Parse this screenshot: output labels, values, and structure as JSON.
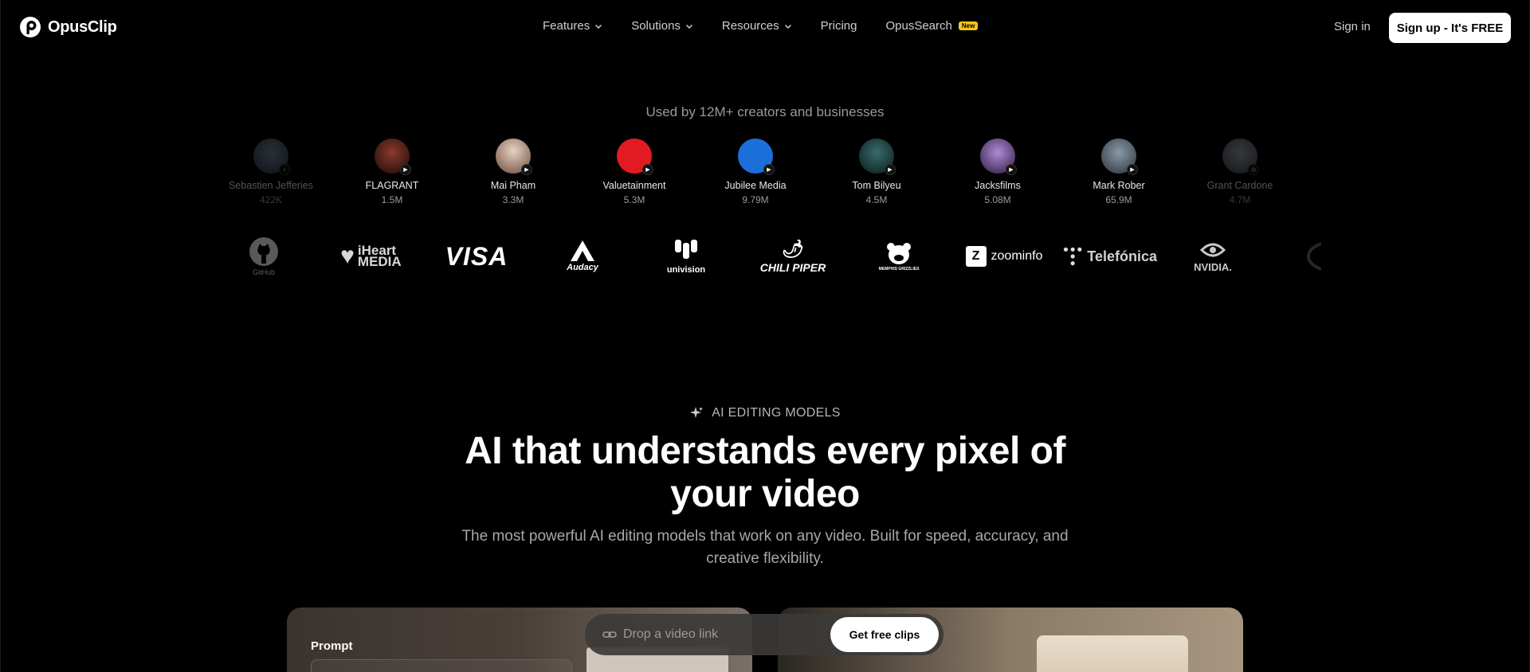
{
  "brand": {
    "name": "OpusClip",
    "logo_icon": "opusclip-logo"
  },
  "nav": {
    "items": [
      {
        "label": "Features",
        "has_dropdown": true
      },
      {
        "label": "Solutions",
        "has_dropdown": true
      },
      {
        "label": "Resources",
        "has_dropdown": true
      },
      {
        "label": "Pricing",
        "has_dropdown": false
      },
      {
        "label": "OpusSearch",
        "has_dropdown": false,
        "badge": "New"
      }
    ],
    "signin": "Sign in",
    "signup": "Sign up - It's FREE"
  },
  "social_proof": {
    "headline": "Used by 12M+ creators and businesses",
    "creators": [
      {
        "name": "Sebastien Jefferies",
        "count": "422K",
        "platform": "tiktok"
      },
      {
        "name": "FLAGRANT",
        "count": "1.5M",
        "platform": "youtube"
      },
      {
        "name": "Mai Pham",
        "count": "3.3M",
        "platform": "youtube"
      },
      {
        "name": "Valuetainment",
        "count": "5.3M",
        "platform": "youtube"
      },
      {
        "name": "Jubilee Media",
        "count": "9.79M",
        "platform": "youtube"
      },
      {
        "name": "Tom Bilyeu",
        "count": "4.5M",
        "platform": "youtube"
      },
      {
        "name": "Jacksfilms",
        "count": "5.08M",
        "platform": "youtube"
      },
      {
        "name": "Mark Rober",
        "count": "65.9M",
        "platform": "youtube"
      },
      {
        "name": "Grant Cardone",
        "count": "4.7M",
        "platform": "instagram"
      }
    ],
    "brands": [
      "GitHub",
      "iHeart MEDIA",
      "VISA",
      "Audacy",
      "univision",
      "CHILI PIPER",
      "MEMPHIS GRIZZLIES",
      "zoominfo",
      "Telefónica",
      "NVIDIA."
    ]
  },
  "hero": {
    "eyebrow": "AI EDITING MODELS",
    "title": "AI that understands every pixel of your video",
    "subtitle": "The most powerful AI editing models that work on any video. Built for speed, accuracy, and creative flexibility."
  },
  "demo": {
    "prompt_label": "Prompt",
    "drop_placeholder": "Drop a video link",
    "cta": "Get free clips"
  }
}
